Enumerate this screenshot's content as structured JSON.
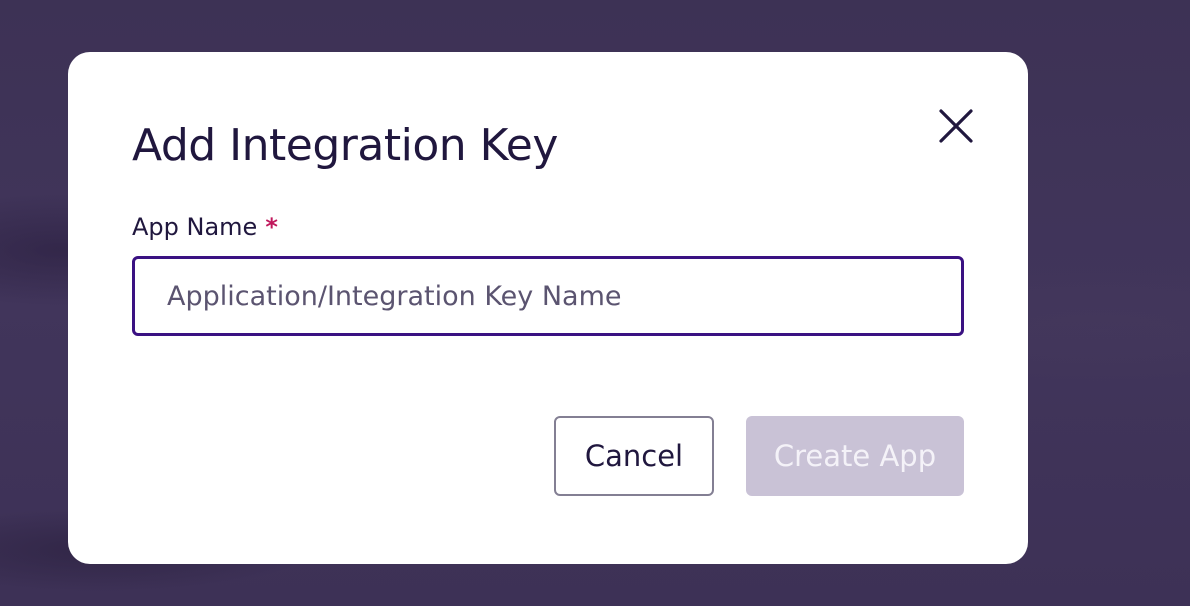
{
  "modal": {
    "title": "Add Integration Key",
    "close_icon": "close-icon",
    "field": {
      "label": "App Name",
      "required_mark": "*",
      "value": "",
      "placeholder": "Application/Integration Key Name"
    },
    "buttons": {
      "cancel_label": "Cancel",
      "create_label": "Create App",
      "create_disabled": true
    }
  },
  "colors": {
    "backdrop": "#3e3257",
    "text_primary": "#20173e",
    "accent_border": "#3a1182",
    "required": "#c0185c",
    "disabled_button": "#c9c2d6"
  }
}
